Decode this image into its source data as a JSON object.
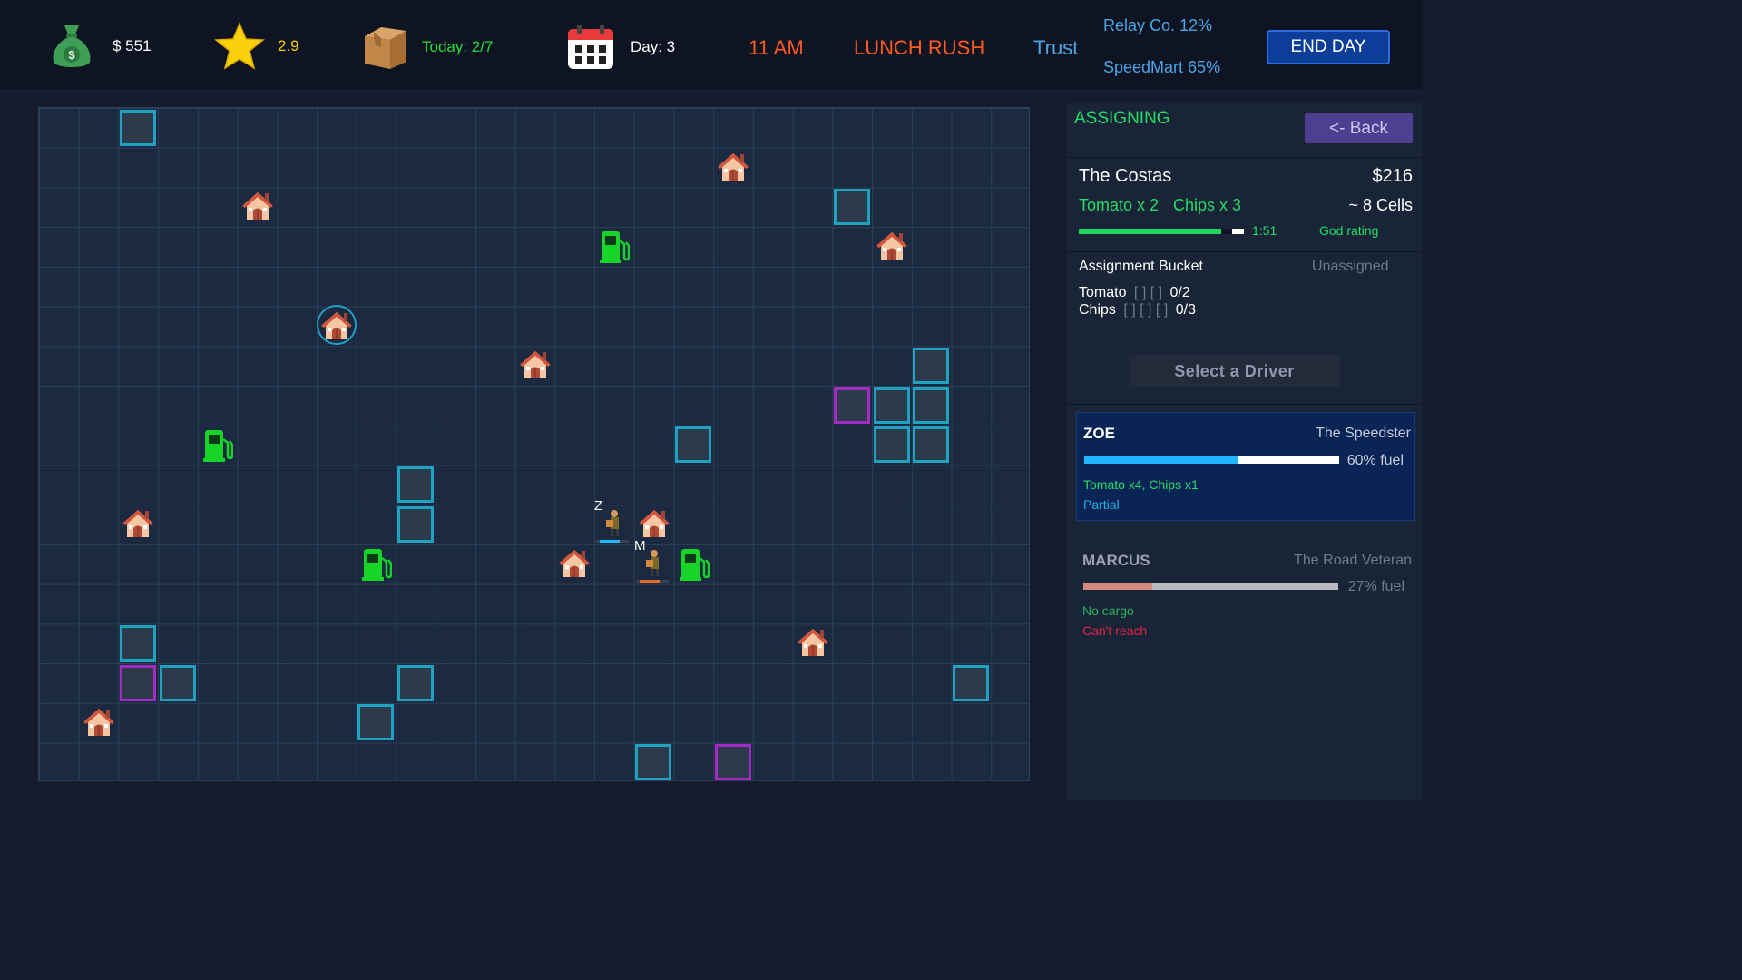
{
  "topbar": {
    "money": "$ 551",
    "rating": "2.9",
    "today": "Today: 2/7",
    "day": "Day: 3",
    "time": "11 AM",
    "phase": "LUNCH RUSH",
    "trust_label": "Trust",
    "rivals": [
      "Relay Co. 12%",
      "SpeedMart 65%"
    ],
    "end_day_label": "END DAY",
    "icons": [
      "money-bag-icon",
      "star-icon",
      "package-icon",
      "calendar-icon"
    ]
  },
  "map": {
    "cols": 25,
    "rows": 17,
    "obstacles_cyan": [
      [
        2,
        0
      ],
      [
        20,
        2
      ],
      [
        22,
        6
      ],
      [
        21,
        7
      ],
      [
        22,
        7
      ],
      [
        16,
        8
      ],
      [
        21,
        8
      ],
      [
        22,
        8
      ],
      [
        9,
        9
      ],
      [
        9,
        10
      ],
      [
        2,
        13
      ],
      [
        3,
        14
      ],
      [
        9,
        14
      ],
      [
        23,
        14
      ],
      [
        8,
        15
      ],
      [
        15,
        16
      ]
    ],
    "obstacles_purple": [
      [
        20,
        7
      ],
      [
        2,
        14
      ],
      [
        17,
        16
      ]
    ],
    "houses": [
      [
        17,
        1
      ],
      [
        5,
        2
      ],
      [
        21,
        3
      ],
      [
        7,
        5
      ],
      [
        12,
        6
      ],
      [
        2,
        10
      ],
      [
        15,
        10
      ],
      [
        13,
        11
      ],
      [
        19,
        13
      ],
      [
        1,
        15
      ]
    ],
    "selected_house": [
      7,
      5
    ],
    "fuel_stations": [
      [
        14,
        3
      ],
      [
        4,
        8
      ],
      [
        8,
        11
      ],
      [
        16,
        11
      ]
    ],
    "drivers": [
      {
        "label": "Z",
        "bar_color": "#1fb6ff"
      },
      {
        "label": "M",
        "bar_color": "#e06a2a"
      }
    ]
  },
  "panel": {
    "mode": "ASSIGNING",
    "back_label": "<- Back",
    "order": {
      "customer": "The Costas",
      "price": "$216",
      "items": [
        "Tomato x 2",
        "Chips x 3"
      ],
      "distance": "~ 8 Cells",
      "timer": "1:51",
      "timer_progress": 0.93,
      "rating": "God rating"
    },
    "bucket": {
      "title": "Assignment Bucket",
      "status": "Unassigned",
      "rows": [
        {
          "name": "Tomato",
          "slots": "[ ] [ ]",
          "count": "0/2"
        },
        {
          "name": "Chips",
          "slots": "[ ] [ ] [ ]",
          "count": "0/3"
        }
      ]
    },
    "select_driver_label": "Select a Driver",
    "drivers": [
      {
        "name": "ZOE",
        "title": "The Speedster",
        "fuel_text": "60% fuel",
        "fuel": 0.6,
        "cargo": "Tomato x4, Chips x1",
        "status": "Partial"
      },
      {
        "name": "MARCUS",
        "title": "The Road Veteran",
        "fuel_text": "27% fuel",
        "fuel": 0.27,
        "cargo": "No cargo",
        "status": "Can't reach"
      }
    ],
    "colors": {
      "accent_green": "#22dd66",
      "driver_selected_bg": "#0a2455",
      "zoe_fuel": "#1fb6ff",
      "marcus_fuel": "#d48a80",
      "warning": "#e0254a"
    }
  }
}
